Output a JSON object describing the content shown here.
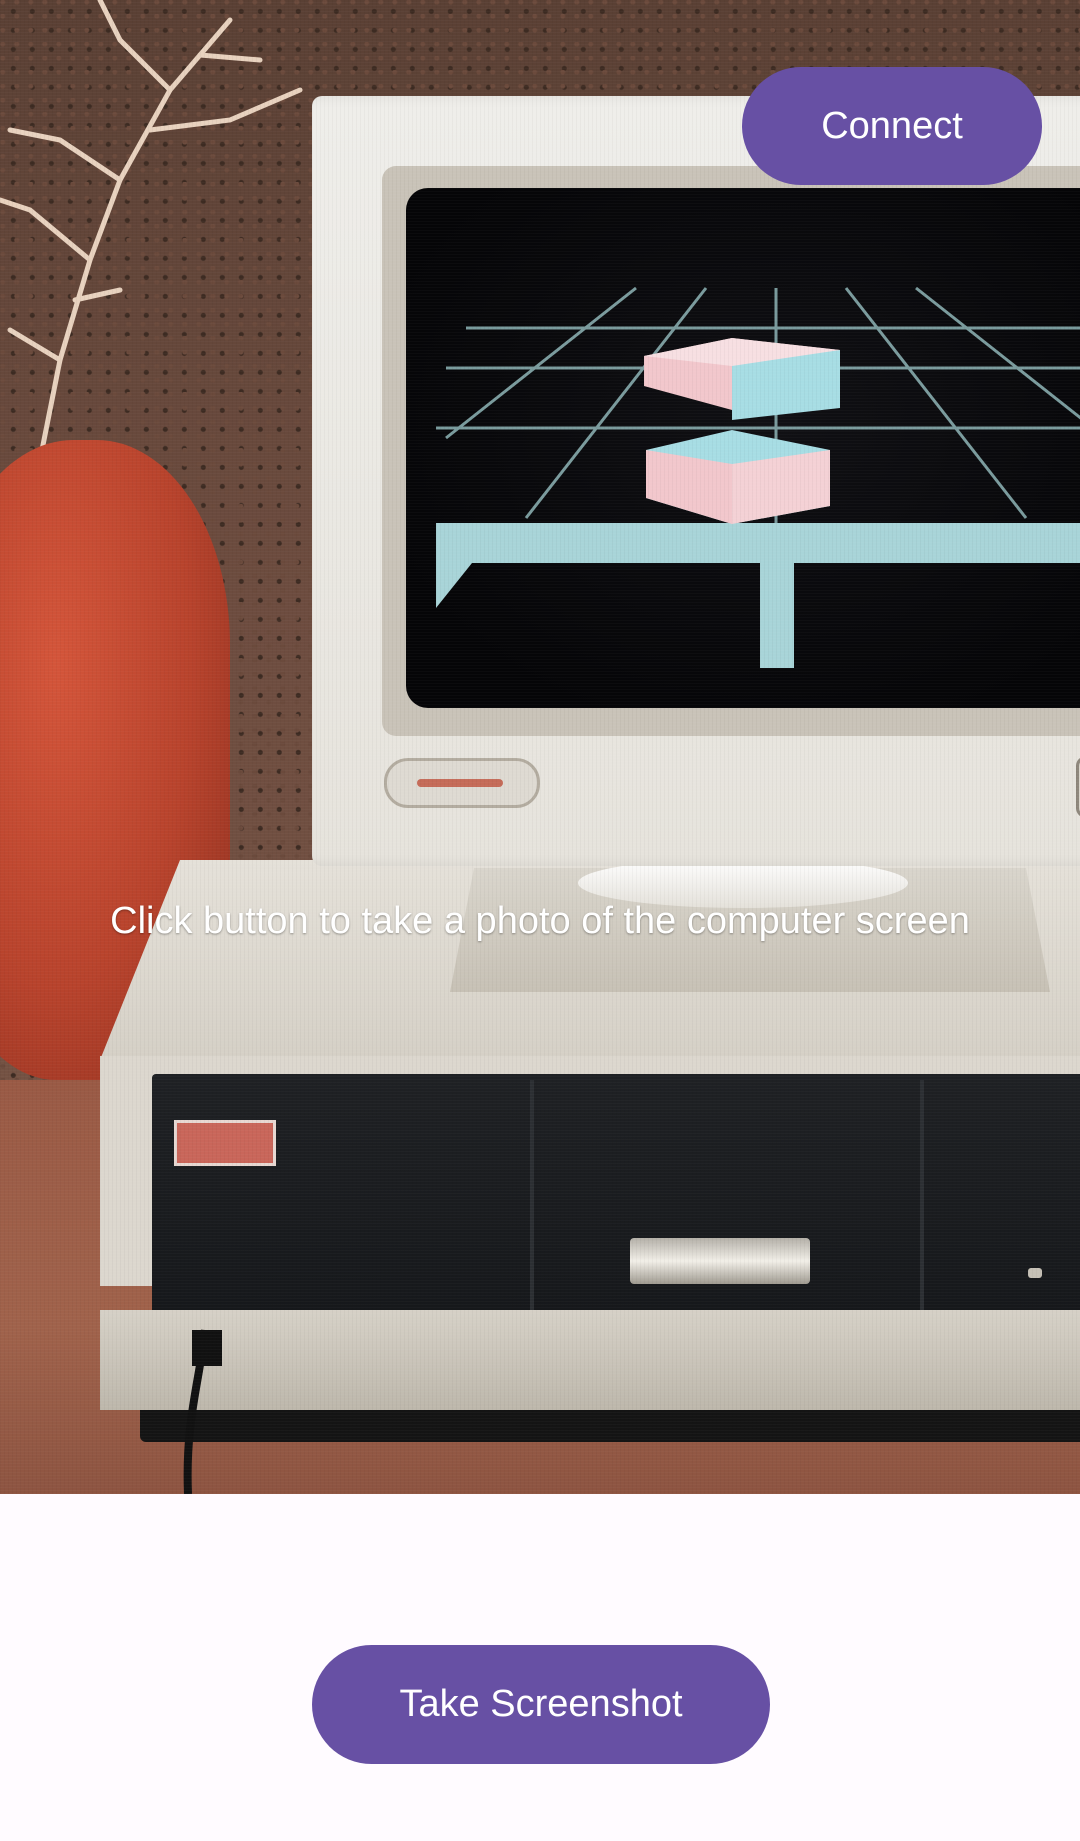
{
  "photo": {
    "subject_icon": "retro-computer-photo"
  },
  "header": {
    "connect_label": "Connect"
  },
  "overlay": {
    "hint": "Click button to take a photo of the computer screen"
  },
  "footer": {
    "take_screenshot_label": "Take Screenshot"
  },
  "colors": {
    "primary_button": "#6750a4",
    "button_text": "#ffffff",
    "background": "#fffbff"
  }
}
